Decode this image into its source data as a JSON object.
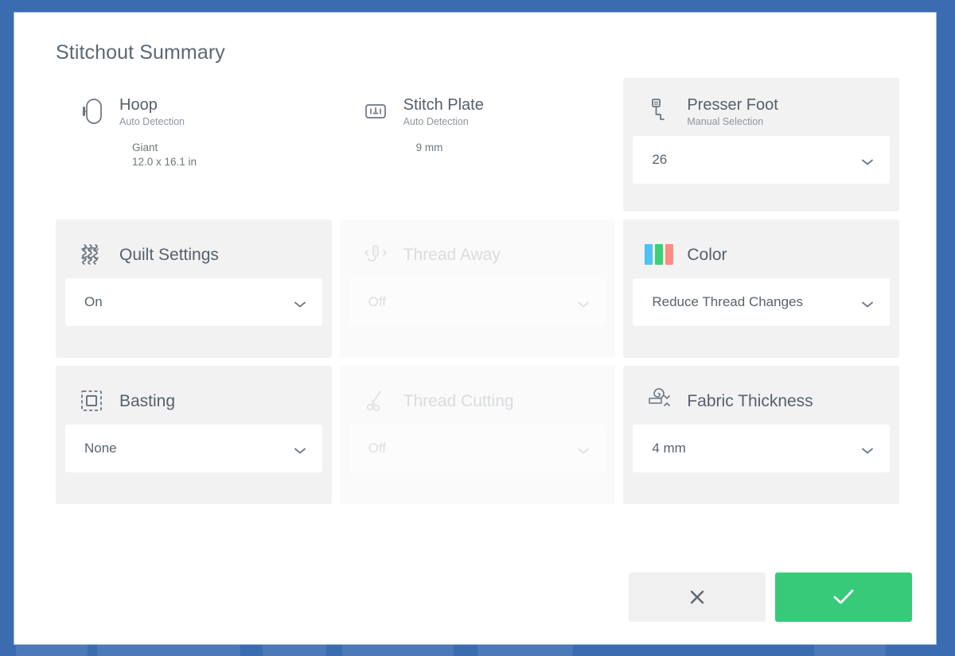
{
  "theme": {
    "background_blue": "#3b6cb0",
    "dialog_bg": "#ffffff",
    "card_filled": "#f2f2f2",
    "confirm_green": "#37ca79",
    "cancel_gray": "#f0f0f0",
    "title_color": "#5a6876",
    "color_swatch": [
      "#4cc3f0",
      "#3ece74",
      "#fb8c84"
    ]
  },
  "dialog": {
    "title": "Stitchout Summary"
  },
  "cards": {
    "hoop": {
      "icon": "hoop-icon",
      "title": "Hoop",
      "subtitle": "Auto Detection",
      "detail_line_1": "Giant",
      "detail_line_2": "12.0 x 16.1 in"
    },
    "stitch_plate": {
      "icon": "stitch-plate-icon",
      "title": "Stitch Plate",
      "subtitle": "Auto Detection",
      "detail_line_1": "9 mm",
      "detail_line_2": ""
    },
    "presser_foot": {
      "icon": "presser-foot-icon",
      "title": "Presser Foot",
      "subtitle": "Manual Selection",
      "value": "26"
    },
    "quilt_settings": {
      "icon": "quilt-pattern-icon",
      "title": "Quilt Settings",
      "value": "On"
    },
    "thread_away": {
      "icon": "thread-away-icon",
      "title": "Thread Away",
      "value": "Off"
    },
    "color": {
      "icon": "color-bars-icon",
      "title": "Color",
      "value": "Reduce Thread Changes"
    },
    "basting": {
      "icon": "basting-icon",
      "title": "Basting",
      "value": "None"
    },
    "thread_cutting": {
      "icon": "scissors-icon",
      "title": "Thread Cutting",
      "value": "Off"
    },
    "fabric_thickness": {
      "icon": "fabric-roll-icon",
      "title": "Fabric Thickness",
      "value": "4 mm"
    }
  },
  "footer": {
    "cancel_icon": "close-icon",
    "confirm_icon": "check-icon"
  }
}
